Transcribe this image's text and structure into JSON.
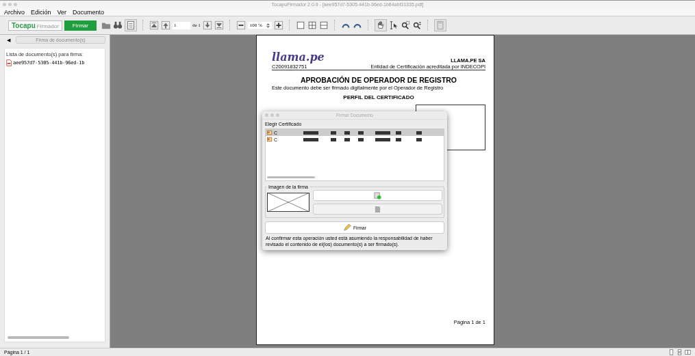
{
  "window": {
    "title": "TocapuFirmador 2.0.9 - [aee957d7-5305-441b-96ed-1b84abf31335.pdf]"
  },
  "menu": [
    "Archivo",
    "Edición",
    "Ver",
    "Documento"
  ],
  "toolbar": {
    "logo": "Tocapu",
    "logo_sub": "Firmador",
    "sign_button": "Firmar",
    "page": "1",
    "page_total": "de 1",
    "zoom": "100 %"
  },
  "sidebar": {
    "collapse_glyph": "◀",
    "button": {
      "label": "Firma de documento(s)",
      "disabled": true
    },
    "list_title": "Lista de documento(s) para firma:",
    "files": [
      "aee957d7-5305-441b-96ed-1b"
    ]
  },
  "document": {
    "brand": "llama.pe",
    "code": "C20091832751",
    "company": "LLAMA.PE SA",
    "entity": "Entidad de Certificación acreditada por INDECOPI",
    "title": "APROBACIÓN DE OPERADOR DE REGISTRO",
    "subtitle": "Este documento debe ser firmado digitalmente por el Operador de Registro",
    "section": "PERFIL DEL CERTIFICADO",
    "footer": "Página 1 de 1"
  },
  "dialog": {
    "title": "Firmar Documento",
    "cert_label": "Elegir Certificado",
    "certificates": [
      {
        "name": "C",
        "selected": true
      },
      {
        "name": "C",
        "selected": false
      }
    ],
    "image_group": "Imagen de la firma",
    "sign_button": "Firmar",
    "notice": "Al confirmar esta operación usted está asumiendo la responsabilidad de haber revisado el contenido de el(los) documento(s) a ser firmado(s)."
  },
  "status_bar": {
    "text": "Página 1 / 1"
  }
}
